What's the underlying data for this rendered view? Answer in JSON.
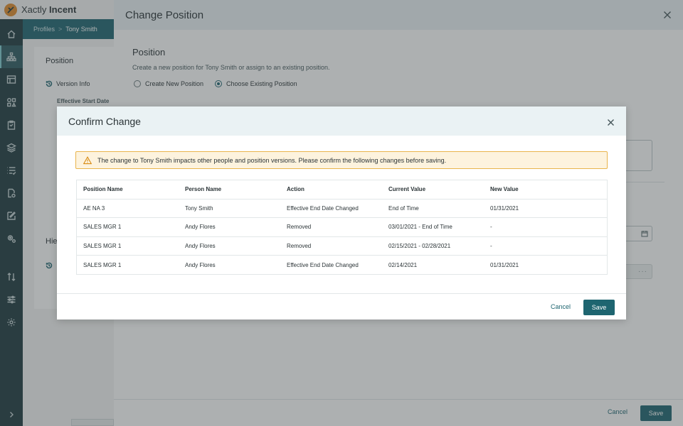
{
  "app": {
    "brand_prefix": "Xactly",
    "brand_name": "Incent"
  },
  "breadcrumb": {
    "parent": "Profiles",
    "separator": ">",
    "current": "Tony Smith"
  },
  "background_page": {
    "section_title": "Position",
    "version_info": "Version Info",
    "effective_start_date": "Effective Start Date",
    "hierarchy_title": "Hie"
  },
  "drawer": {
    "title": "Change Position",
    "section_title": "Position",
    "description": "Create a new position for Tony Smith or assign to an existing position.",
    "radio_new": "Create New Position",
    "radio_existing": "Choose Existing Position",
    "selected_option": "Choose Existing Position",
    "more_placeholder": "···",
    "cancel_label": "Cancel",
    "save_label": "Save"
  },
  "modal": {
    "title": "Confirm Change",
    "alert_text": "The change to Tony Smith impacts other people and position versions. Please confirm the following changes before saving.",
    "columns": [
      "Position Name",
      "Person Name",
      "Action",
      "Current Value",
      "New Value"
    ],
    "rows": [
      [
        "AE NA 3",
        "Tony Smith",
        "Effective End Date Changed",
        "End of Time",
        "01/31/2021"
      ],
      [
        "SALES MGR 1",
        "Andy Flores",
        "Removed",
        "03/01/2021 - End of Time",
        "-"
      ],
      [
        "SALES MGR 1",
        "Andy Flores",
        "Removed",
        "02/15/2021 - 02/28/2021",
        "-"
      ],
      [
        "SALES MGR 1",
        "Andy Flores",
        "Effective End Date Changed",
        "02/14/2021",
        "01/31/2021"
      ]
    ],
    "cancel_label": "Cancel",
    "save_label": "Save"
  },
  "colors": {
    "primary": "#1e6570",
    "rail": "#1e3a3f",
    "warning_bg": "#fdf3de",
    "warning_border": "#e9b44c"
  }
}
